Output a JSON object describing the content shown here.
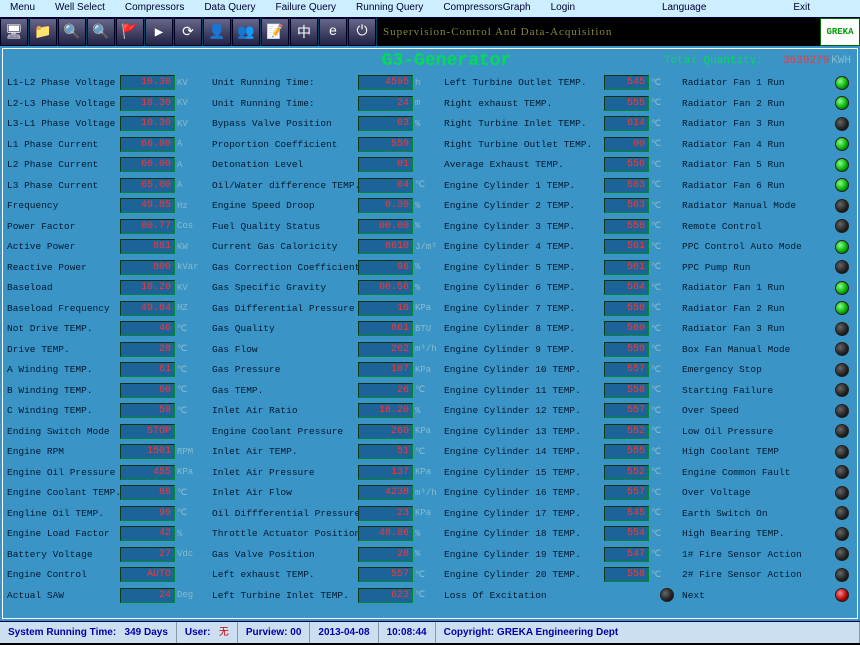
{
  "menu": [
    "Menu",
    "Well Select",
    "Compressors",
    "Data Query",
    "Failure Query",
    "Running Query",
    "CompressorsGraph",
    "Login",
    "Language",
    "Exit"
  ],
  "banner": "Supervision-Control And Data-Acquisition",
  "logo": "GREKA",
  "title": "G3-Generator",
  "total_qty_label": "Total Quantity:",
  "total_qty_value": "3639279",
  "total_qty_unit": "KWH",
  "col1": [
    {
      "l": "L1-L2 Phase Voltage",
      "v": "10.30",
      "u": "KV"
    },
    {
      "l": "L2-L3 Phase Voltage",
      "v": "10.30",
      "u": "KV"
    },
    {
      "l": "L3-L1 Phase Voltage",
      "v": "10.30",
      "u": "KV"
    },
    {
      "l": "L1 Phase Current",
      "v": "66.00",
      "u": "A"
    },
    {
      "l": "L2 Phase Current",
      "v": "66.00",
      "u": "A"
    },
    {
      "l": "L3 Phase Current",
      "v": "65.00",
      "u": "A"
    },
    {
      "l": "Frequency",
      "v": "49.85",
      "u": "Hz"
    },
    {
      "l": "Power Factor",
      "v": "00.77",
      "u": "Cos"
    },
    {
      "l": "Active Power",
      "v": "881",
      "u": "KW"
    },
    {
      "l": "Reactive Power",
      "v": "800",
      "u": "kVar"
    },
    {
      "l": "Baseload",
      "v": "10.20",
      "u": "KV"
    },
    {
      "l": "Baseload Frequency",
      "v": "49.84",
      "u": "HZ"
    },
    {
      "l": "Not Drive TEMP.",
      "v": "46",
      "u": "℃"
    },
    {
      "l": "Drive TEMP.",
      "v": "28",
      "u": "℃"
    },
    {
      "l": "A Winding TEMP.",
      "v": "61",
      "u": "℃"
    },
    {
      "l": "B Winding TEMP.",
      "v": "60",
      "u": "℃"
    },
    {
      "l": "C Winding TEMP.",
      "v": "59",
      "u": "℃"
    },
    {
      "l": "Ending Switch Mode",
      "v": "STOP",
      "u": ""
    },
    {
      "l": "Engine RPM",
      "v": "1501",
      "u": "RPM"
    },
    {
      "l": "Engine Oil Pressure",
      "v": "455",
      "u": "KPa"
    },
    {
      "l": "Engine Coolant TEMP.",
      "v": "86",
      "u": "℃"
    },
    {
      "l": "Engline Oil TEMP.",
      "v": "90",
      "u": "℃"
    },
    {
      "l": "Engine Load Factor",
      "v": "42",
      "u": "%"
    },
    {
      "l": "Battery Voltage",
      "v": "27",
      "u": "Vdc"
    },
    {
      "l": "Engine Control",
      "v": "AUTO",
      "u": ""
    },
    {
      "l": "Actual SAW",
      "v": "24",
      "u": "Deg"
    }
  ],
  "col2": [
    {
      "l": "Unit Running Time:",
      "v": "4595",
      "u": "h"
    },
    {
      "l": "Unit Running Time:",
      "v": "24",
      "u": "m"
    },
    {
      "l": "Bypass Valve Position",
      "v": "03",
      "u": "%"
    },
    {
      "l": "Proportion Coefficient",
      "v": "559",
      "u": ""
    },
    {
      "l": "Detonation Level",
      "v": "01",
      "u": ""
    },
    {
      "l": "Oil/Water difference TEMP.",
      "v": "04",
      "u": "℃"
    },
    {
      "l": "Engine Speed Droop",
      "v": "0.30",
      "u": "%"
    },
    {
      "l": "Fuel Quality Status",
      "v": "00.00",
      "u": "%"
    },
    {
      "l": "Current Gas Caloricity",
      "v": "8610",
      "u": "J/m³"
    },
    {
      "l": "Gas Correction Coefficient",
      "v": "96",
      "u": "%"
    },
    {
      "l": "Gas Specific Gravity",
      "v": "00.56",
      "u": "%"
    },
    {
      "l": "Gas Differential Pressure",
      "v": "16",
      "u": "KPa"
    },
    {
      "l": "Gas Quality",
      "v": "861",
      "u": "BTU"
    },
    {
      "l": "Gas Flow",
      "v": "262",
      "u": "m³/h"
    },
    {
      "l": "Gas Pressure",
      "v": "107",
      "u": "KPa"
    },
    {
      "l": "Gas TEMP.",
      "v": "26",
      "u": "℃"
    },
    {
      "l": "Inlet Air Ratio",
      "v": "16.20",
      "u": "%"
    },
    {
      "l": "Engine Coolant Pressure",
      "v": "260",
      "u": "KPa"
    },
    {
      "l": "Inlet Air TEMP.",
      "v": "51",
      "u": "℃"
    },
    {
      "l": "Inlet Air Pressure",
      "v": "137",
      "u": "KPa"
    },
    {
      "l": "Inlet Air Flow",
      "v": "4238",
      "u": "m³/h"
    },
    {
      "l": "Oil Diffferential Pressure",
      "v": "23",
      "u": "KPa"
    },
    {
      "l": "Throttle Actuator Position",
      "v": "48.86",
      "u": "%"
    },
    {
      "l": "Gas Valve Position",
      "v": "28",
      "u": "%"
    },
    {
      "l": "Left exhaust TEMP.",
      "v": "557",
      "u": "℃"
    },
    {
      "l": "Left Turbine Inlet TEMP.",
      "v": "623",
      "u": "℃"
    }
  ],
  "col3": [
    {
      "l": "Left Turbine Outlet TEMP.",
      "v": "545",
      "u": "℃"
    },
    {
      "l": "Right exhaust TEMP.",
      "v": "555",
      "u": "℃"
    },
    {
      "l": "Right Turbine Inlet TEMP.",
      "v": "614",
      "u": "℃"
    },
    {
      "l": "Right Turbine Outlet TEMP.",
      "v": "00",
      "u": "℃"
    },
    {
      "l": "Average Exhaust TEMP.",
      "v": "556",
      "u": "℃"
    },
    {
      "l": "Engine Cylinder 1 TEMP.",
      "v": "563",
      "u": "℃"
    },
    {
      "l": "Engine Cylinder 2 TEMP.",
      "v": "563",
      "u": "℃"
    },
    {
      "l": "Engine Cylinder 3 TEMP.",
      "v": "558",
      "u": "℃"
    },
    {
      "l": "Engine Cylinder 4 TEMP.",
      "v": "561",
      "u": "℃"
    },
    {
      "l": "Engine Cylinder 5 TEMP.",
      "v": "561",
      "u": "℃"
    },
    {
      "l": "Engine Cylinder 6 TEMP.",
      "v": "564",
      "u": "℃"
    },
    {
      "l": "Engine Cylinder 7 TEMP.",
      "v": "558",
      "u": "℃"
    },
    {
      "l": "Engine Cylinder 8 TEMP.",
      "v": "560",
      "u": "℃"
    },
    {
      "l": "Engine Cylinder 9 TEMP.",
      "v": "559",
      "u": "℃"
    },
    {
      "l": "Engine Cylinder 10 TEMP.",
      "v": "557",
      "u": "℃"
    },
    {
      "l": "Engine Cylinder 11 TEMP.",
      "v": "558",
      "u": "℃"
    },
    {
      "l": "Engine Cylinder 12 TEMP.",
      "v": "557",
      "u": "℃"
    },
    {
      "l": "Engine Cylinder 13 TEMP.",
      "v": "552",
      "u": "℃"
    },
    {
      "l": "Engine Cylinder 14 TEMP.",
      "v": "555",
      "u": "℃"
    },
    {
      "l": "Engine Cylinder 15 TEMP.",
      "v": "552",
      "u": "℃"
    },
    {
      "l": "Engine Cylinder 16 TEMP.",
      "v": "557",
      "u": "℃"
    },
    {
      "l": "Engine Cylinder 17 TEMP.",
      "v": "545",
      "u": "℃"
    },
    {
      "l": "Engine Cylinder 18 TEMP.",
      "v": "554",
      "u": "℃"
    },
    {
      "l": "Engine Cylinder 19 TEMP.",
      "v": "547",
      "u": "℃"
    },
    {
      "l": "Engine Cylinder 20 TEMP.",
      "v": "558",
      "u": "℃"
    },
    {
      "l": "Loss Of Excitation",
      "v": "",
      "u": "",
      "led": "dark"
    }
  ],
  "col4": [
    {
      "l": "Radiator Fan 1 Run",
      "led": "green"
    },
    {
      "l": "Radiator Fan 2 Run",
      "led": "green"
    },
    {
      "l": "Radiator Fan 3 Run",
      "led": "dark"
    },
    {
      "l": "Radiator Fan 4 Run",
      "led": "green"
    },
    {
      "l": "Radiator Fan 5 Run",
      "led": "green"
    },
    {
      "l": "Radiator Fan 6 Run",
      "led": "green"
    },
    {
      "l": "Radiator Manual Mode",
      "led": "dark"
    },
    {
      "l": "Remote Control",
      "led": "dark"
    },
    {
      "l": "PPC Control Auto Mode",
      "led": "green"
    },
    {
      "l": "PPC Pump Run",
      "led": "dark"
    },
    {
      "l": "Radiator Fan 1 Run",
      "led": "green"
    },
    {
      "l": "Radiator Fan 2 Run",
      "led": "green"
    },
    {
      "l": "Radiator Fan 3 Run",
      "led": "dark"
    },
    {
      "l": "Box Fan Manual Mode",
      "led": "dark"
    },
    {
      "l": "Emergency Stop",
      "led": "dark"
    },
    {
      "l": "Starting Failure",
      "led": "dark"
    },
    {
      "l": "Over Speed",
      "led": "dark"
    },
    {
      "l": "Low Oil Pressure",
      "led": "dark"
    },
    {
      "l": "High Coolant TEMP",
      "led": "dark"
    },
    {
      "l": "Engine Common Fault",
      "led": "dark"
    },
    {
      "l": "Over Voltage",
      "led": "dark"
    },
    {
      "l": "Earth Switch On",
      "led": "dark"
    },
    {
      "l": "High Bearing TEMP.",
      "led": "dark"
    },
    {
      "l": "1# Fire Sensor Action",
      "led": "dark"
    },
    {
      "l": "2# Fire Sensor Action",
      "led": "dark"
    },
    {
      "l": "Next",
      "led": "red"
    }
  ],
  "status": {
    "srt_label": "System Running Time:",
    "srt_value": "349 Days",
    "user_label": "User:",
    "user_value": "无",
    "purview_label": "Purview:",
    "purview_value": "00",
    "date": "2013-04-08",
    "time": "10:08:44",
    "copy_label": "Copyright:",
    "copy_value": "GREKA Engineering Dept"
  },
  "toolbar_icons": [
    "🖥",
    "📁",
    "🔍",
    "🔍",
    "🚩",
    "▶",
    "⟳",
    "👤",
    "👥",
    "📝",
    "中",
    "e",
    "⏻"
  ]
}
